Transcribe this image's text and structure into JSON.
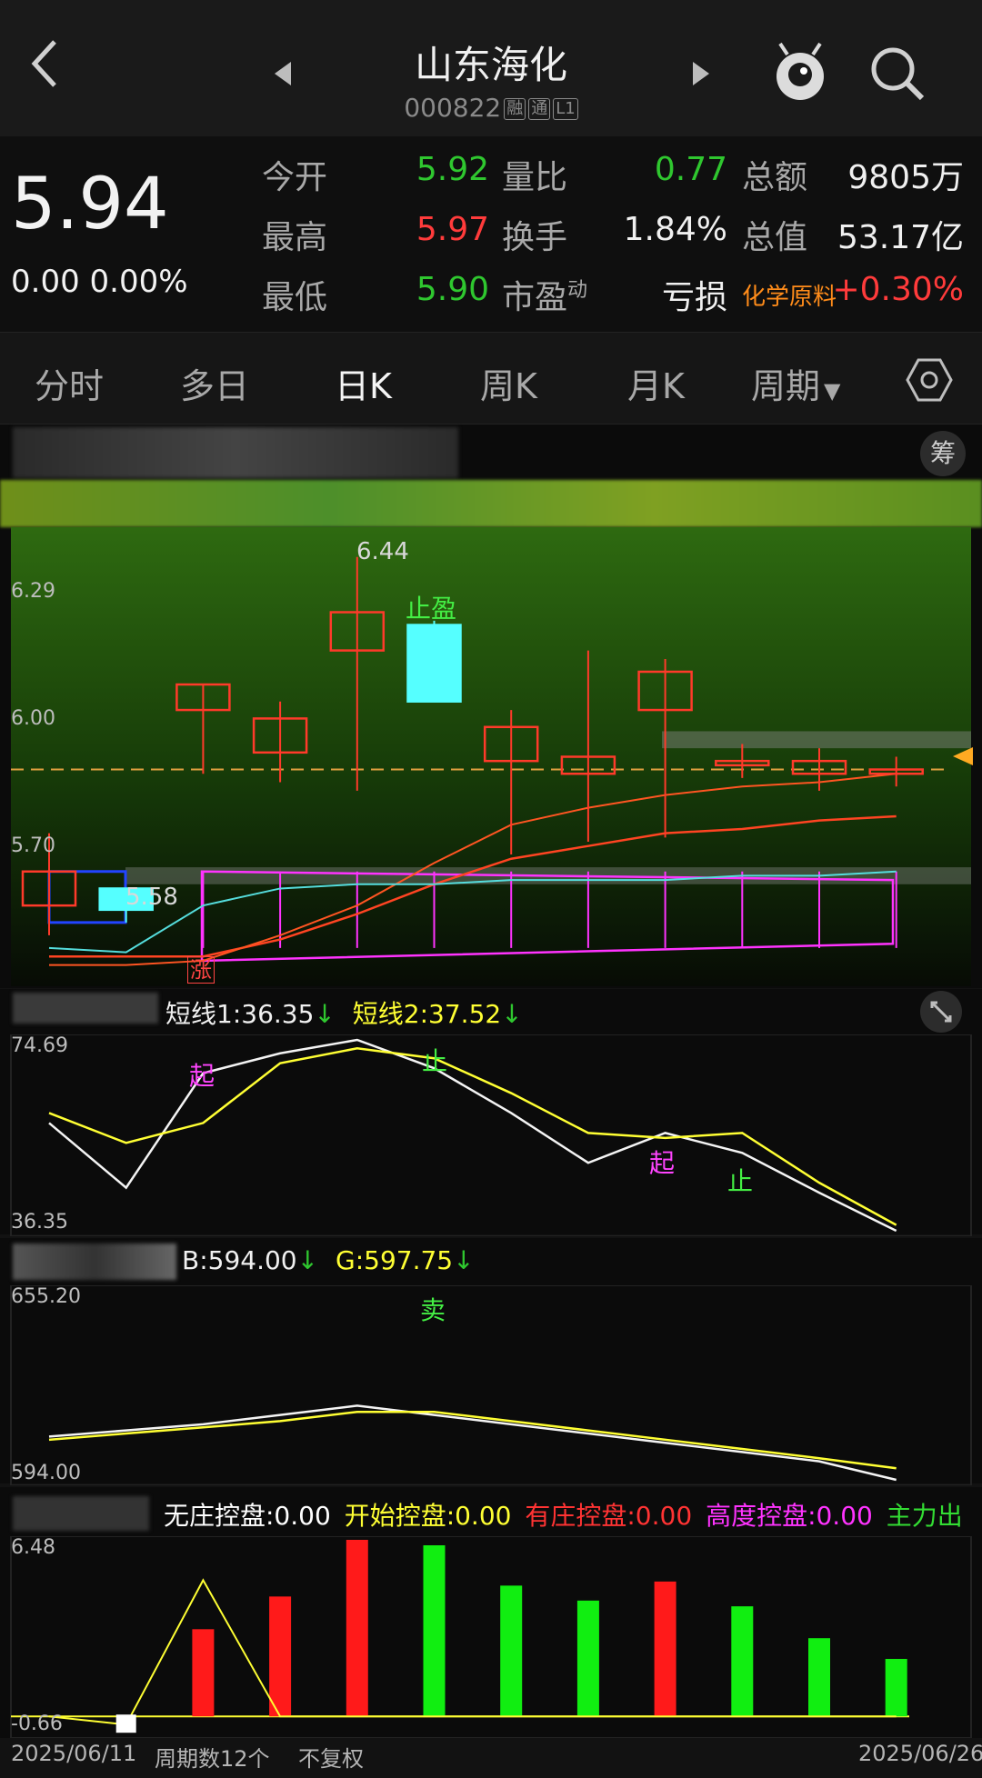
{
  "header": {
    "title": "山东海化",
    "code": "000822",
    "tags": [
      "融",
      "通",
      "L1"
    ]
  },
  "quote": {
    "price": "5.94",
    "change": "0.00",
    "change_pct": "0.00%",
    "rows": [
      {
        "l1": "今开",
        "v1": "5.92",
        "l2": "量比",
        "v2": "0.77",
        "l3": "总额",
        "v3": "9805万"
      },
      {
        "l1": "最高",
        "v1": "5.97",
        "l2": "换手",
        "v2": "1.84%",
        "l3": "总值",
        "v3": "53.17亿"
      },
      {
        "l1": "最低",
        "v1": "5.90",
        "l2": "市盈",
        "l2sup": "动",
        "v2": "亏损",
        "l3": "化学原料",
        "v3": "+0.30%"
      }
    ],
    "colors": {
      "up": "#ff3b3b",
      "down": "#2fc72f",
      "sector": "#ff8c1a"
    }
  },
  "tabs": [
    "分时",
    "多日",
    "日K",
    "周K",
    "月K",
    "周期"
  ],
  "active_tab": "日K",
  "main_chart": {
    "chip_button": "筹",
    "price_labels": {
      "p629": "6.29",
      "p600": "6.00",
      "p570": "5.70"
    },
    "high_label": "6.44",
    "low_label": "5.58",
    "stop_profit": "止盈",
    "rise_tag": "涨"
  },
  "ind1": {
    "line1": "短线1:36.35",
    "line2": "短线2:37.52",
    "max": "74.69",
    "min": "36.35",
    "marks": {
      "start1": "起",
      "stop1": "止",
      "start2": "起",
      "stop2": "止"
    }
  },
  "ind2": {
    "b": "B:594.00",
    "g": "G:597.75",
    "max": "655.20",
    "min": "594.00",
    "sell": "卖"
  },
  "ind3": {
    "items": [
      "无庄控盘:0.00",
      "开始控盘:0.00",
      "有庄控盘:0.00",
      "高度控盘:0.00",
      "主力出"
    ],
    "colors": [
      "#ffffff",
      "#ffff33",
      "#ff3333",
      "#ff33ff",
      "#33dd33"
    ],
    "max": "6.48",
    "min": "-0.66"
  },
  "footer": {
    "start_date": "2025/06/11",
    "period_count": "周期数12个",
    "adjust": "不复权",
    "end_date": "2025/06/26"
  },
  "chart_data": [
    {
      "type": "candlestick",
      "x": [
        "2025/06/11",
        "",
        "",
        "",
        "",
        "",
        "",
        "",
        "",
        "",
        "",
        "2025/06/26"
      ],
      "open": [
        5.62,
        5.66,
        6.08,
        5.98,
        6.22,
        6.28,
        5.96,
        5.93,
        6.08,
        5.95,
        5.93,
        5.93
      ],
      "close": [
        5.7,
        5.61,
        6.14,
        6.06,
        6.31,
        6.1,
        6.04,
        5.97,
        6.17,
        5.96,
        5.96,
        5.94
      ],
      "high": [
        5.79,
        5.66,
        6.14,
        6.1,
        6.44,
        6.29,
        6.08,
        6.22,
        6.2,
        6.0,
        5.99,
        5.97
      ],
      "low": [
        5.55,
        5.58,
        5.93,
        5.91,
        5.89,
        6.27,
        5.74,
        5.77,
        5.78,
        5.92,
        5.89,
        5.9
      ],
      "ylim": [
        5.43,
        6.51
      ],
      "ref_price": 5.94
    },
    {
      "type": "line",
      "series": [
        {
          "name": "短线1",
          "values": [
            58,
            45,
            68,
            72,
            74.69,
            69,
            60,
            50,
            56,
            52,
            44,
            36.35
          ]
        },
        {
          "name": "短线2",
          "values": [
            60,
            54,
            58,
            70,
            73,
            71,
            64,
            56,
            55,
            56,
            46,
            37.52
          ]
        }
      ],
      "ylim": [
        36.35,
        74.69
      ]
    },
    {
      "type": "line",
      "series": [
        {
          "name": "B",
          "values": [
            608,
            610,
            612,
            615,
            618,
            615,
            612,
            609,
            606,
            603,
            600,
            594.0
          ]
        },
        {
          "name": "G",
          "values": [
            607,
            609,
            611,
            613,
            616,
            616,
            613,
            610,
            607,
            604,
            601,
            597.75
          ]
        }
      ],
      "ylim": [
        594.0,
        655.2
      ]
    },
    {
      "type": "bar",
      "values": [
        0,
        0,
        3.2,
        4.4,
        6.48,
        6.28,
        4.8,
        4.25,
        4.95,
        4.04,
        2.87,
        2.11
      ],
      "colors": [
        "",
        "",
        "red",
        "red",
        "red",
        "green",
        "green",
        "green",
        "red",
        "green",
        "green",
        "green"
      ],
      "line": [
        0,
        -0.3,
        5.0,
        0,
        0,
        0,
        0,
        0,
        0,
        0,
        0,
        0
      ],
      "ylim": [
        -0.66,
        6.48
      ]
    }
  ]
}
